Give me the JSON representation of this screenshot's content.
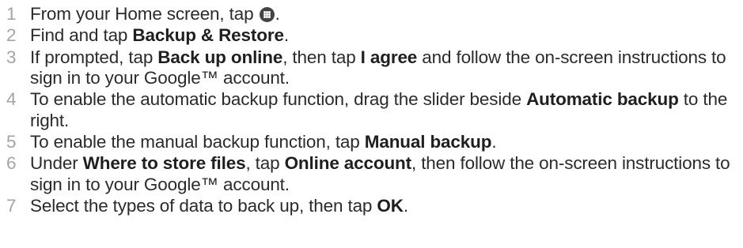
{
  "steps": [
    {
      "number": "1",
      "segments": [
        {
          "text": "From your Home screen, tap ",
          "bold": false
        },
        {
          "icon": "apps-grid-icon"
        },
        {
          "text": ".",
          "bold": false
        }
      ]
    },
    {
      "number": "2",
      "segments": [
        {
          "text": "Find and tap ",
          "bold": false
        },
        {
          "text": "Backup & Restore",
          "bold": true
        },
        {
          "text": ".",
          "bold": false
        }
      ]
    },
    {
      "number": "3",
      "segments": [
        {
          "text": "If prompted, tap ",
          "bold": false
        },
        {
          "text": "Back up online",
          "bold": true
        },
        {
          "text": ", then tap ",
          "bold": false
        },
        {
          "text": "I agree",
          "bold": true
        },
        {
          "text": " and follow the on-screen instructions to sign in to your Google™ account.",
          "bold": false
        }
      ]
    },
    {
      "number": "4",
      "segments": [
        {
          "text": "To enable the automatic backup function, drag the slider beside ",
          "bold": false
        },
        {
          "text": "Automatic backup",
          "bold": true
        },
        {
          "text": " to the right.",
          "bold": false
        }
      ]
    },
    {
      "number": "5",
      "segments": [
        {
          "text": "To enable the manual backup function, tap ",
          "bold": false
        },
        {
          "text": "Manual backup",
          "bold": true
        },
        {
          "text": ".",
          "bold": false
        }
      ]
    },
    {
      "number": "6",
      "segments": [
        {
          "text": "Under ",
          "bold": false
        },
        {
          "text": "Where to store files",
          "bold": true
        },
        {
          "text": ", tap ",
          "bold": false
        },
        {
          "text": "Online account",
          "bold": true
        },
        {
          "text": ", then follow the on-screen instructions to sign in to your Google™ account.",
          "bold": false
        }
      ]
    },
    {
      "number": "7",
      "segments": [
        {
          "text": "Select the types of data to back up, then tap ",
          "bold": false
        },
        {
          "text": "OK",
          "bold": true
        },
        {
          "text": ".",
          "bold": false
        }
      ]
    }
  ]
}
